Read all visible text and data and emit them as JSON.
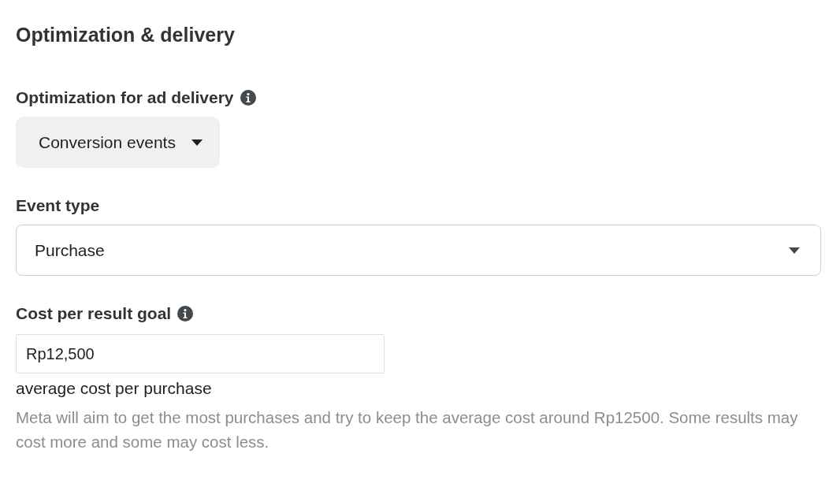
{
  "section_title": "Optimization & delivery",
  "optimization": {
    "label": "Optimization for ad delivery",
    "value": "Conversion events"
  },
  "event_type": {
    "label": "Event type",
    "value": "Purchase"
  },
  "cost_goal": {
    "label": "Cost per result goal",
    "value": "Rp12,500",
    "unit": "average cost per purchase",
    "help": "Meta will aim to get the most purchases and try to keep the average cost around Rp12500. Some results may cost more and some may cost less."
  }
}
